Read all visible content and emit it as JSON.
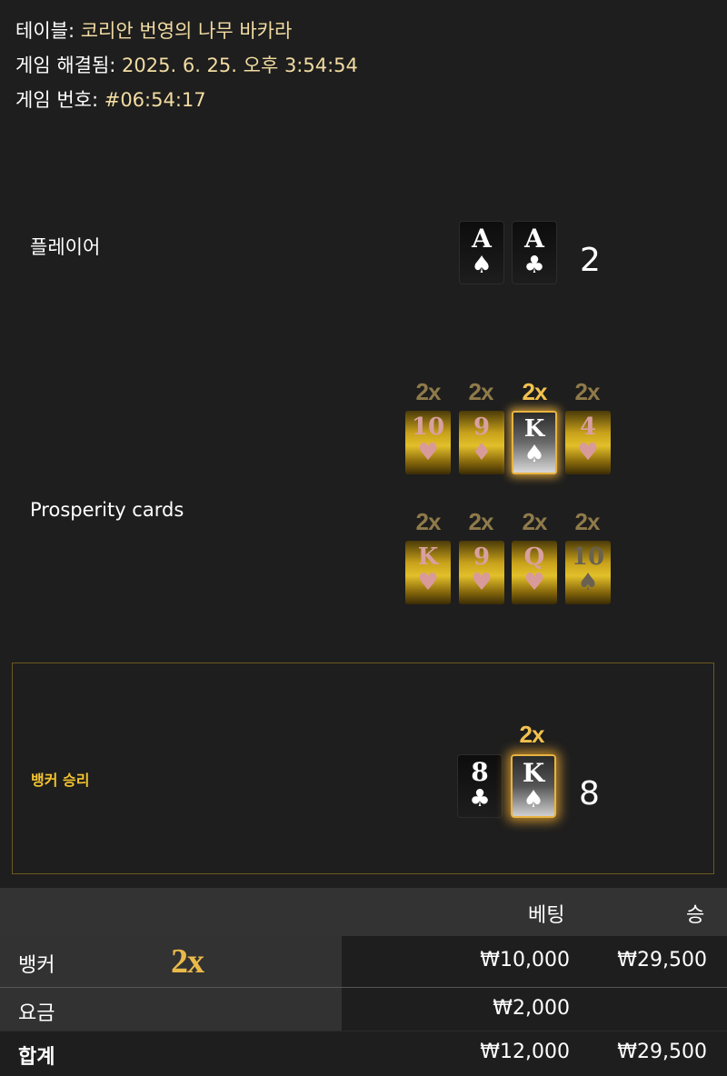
{
  "info": {
    "table_label": "테이블:",
    "table_value": "코리안 번영의 나무 바카라",
    "resolved_label": "게임 해결됨:",
    "resolved_value": "2025. 6. 25. 오후 3:54:54",
    "game_label": "게임 번호:",
    "game_value": "#06:54:17"
  },
  "player": {
    "label": "플레이어",
    "score": "2",
    "cards": [
      {
        "rank": "A",
        "suit": "♠"
      },
      {
        "rank": "A",
        "suit": "♣"
      }
    ]
  },
  "prosperity": {
    "label": "Prosperity cards",
    "row1": [
      {
        "mult": "2x",
        "rank": "10",
        "suit": "♥"
      },
      {
        "mult": "2x",
        "rank": "9",
        "suit": "♦"
      },
      {
        "mult": "2x",
        "rank": "K",
        "suit": "♠"
      },
      {
        "mult": "2x",
        "rank": "4",
        "suit": "♥"
      }
    ],
    "row2": [
      {
        "mult": "2x",
        "rank": "K",
        "suit": "♥"
      },
      {
        "mult": "2x",
        "rank": "9",
        "suit": "♥"
      },
      {
        "mult": "2x",
        "rank": "Q",
        "suit": "♥"
      },
      {
        "mult": "2x",
        "rank": "10",
        "suit": "♠"
      }
    ]
  },
  "banker": {
    "label": "뱅커 승리",
    "score": "8",
    "card_mult": "2x",
    "cards": [
      {
        "rank": "8",
        "suit": "♣"
      },
      {
        "rank": "K",
        "suit": "♠"
      }
    ]
  },
  "table": {
    "header_bet": "베팅",
    "header_win": "승",
    "rows": [
      {
        "label": "뱅커",
        "mult": "2x",
        "bet": "₩10,000",
        "win": "₩29,500"
      },
      {
        "label": "요금",
        "bet": "₩2,000",
        "win": ""
      },
      {
        "label": "합계",
        "bet": "₩12,000",
        "win": "₩29,500"
      }
    ]
  },
  "colors": {
    "accent_gold": "#f1c24e",
    "win_label": "#f4c430",
    "background": "#1e1e1e"
  }
}
